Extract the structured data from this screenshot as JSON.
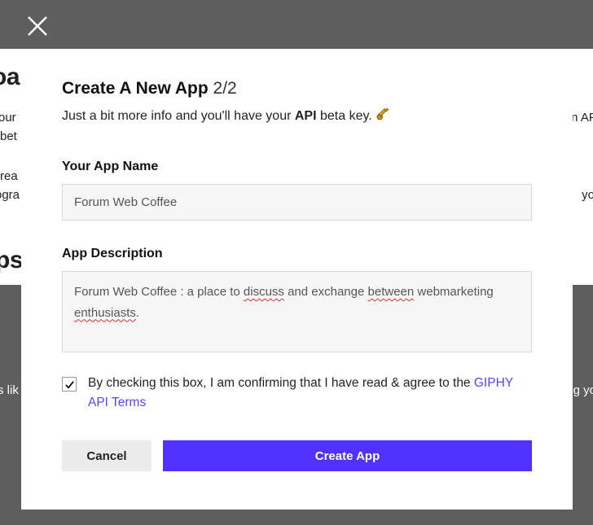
{
  "background": {
    "heading1_fragment": "oa",
    "para1_line1": "our",
    "para1_line2": "bet",
    "para2_line1": "rea",
    "para2_line2": "ogra",
    "heading2_fragment": "ps",
    "lower_left": "s lik",
    "right_frag1": "n AF",
    "right_frag2": "yo",
    "right_frag3": "g yo"
  },
  "modal": {
    "title_bold": "Create A New App",
    "title_step": "2/2",
    "subtitle_pre": "Just a bit more info and you'll have your ",
    "subtitle_bold": "API",
    "subtitle_post": " beta key. ",
    "app_name": {
      "label": "Your App Name",
      "value": "Forum Web Coffee"
    },
    "app_description": {
      "label": "App Description",
      "text_parts": {
        "p1": "Forum Web Coffee : a place to ",
        "w1": "discuss",
        "p2": " and exchange ",
        "w2": "between",
        "p3": " webmarketing ",
        "w3": "enthusiasts",
        "p4": "."
      }
    },
    "consent": {
      "checked": true,
      "text": "By checking this box, I am confirming that I have read & agree to the ",
      "link": "GIPHY API Terms"
    },
    "buttons": {
      "cancel": "Cancel",
      "create": "Create App"
    }
  }
}
